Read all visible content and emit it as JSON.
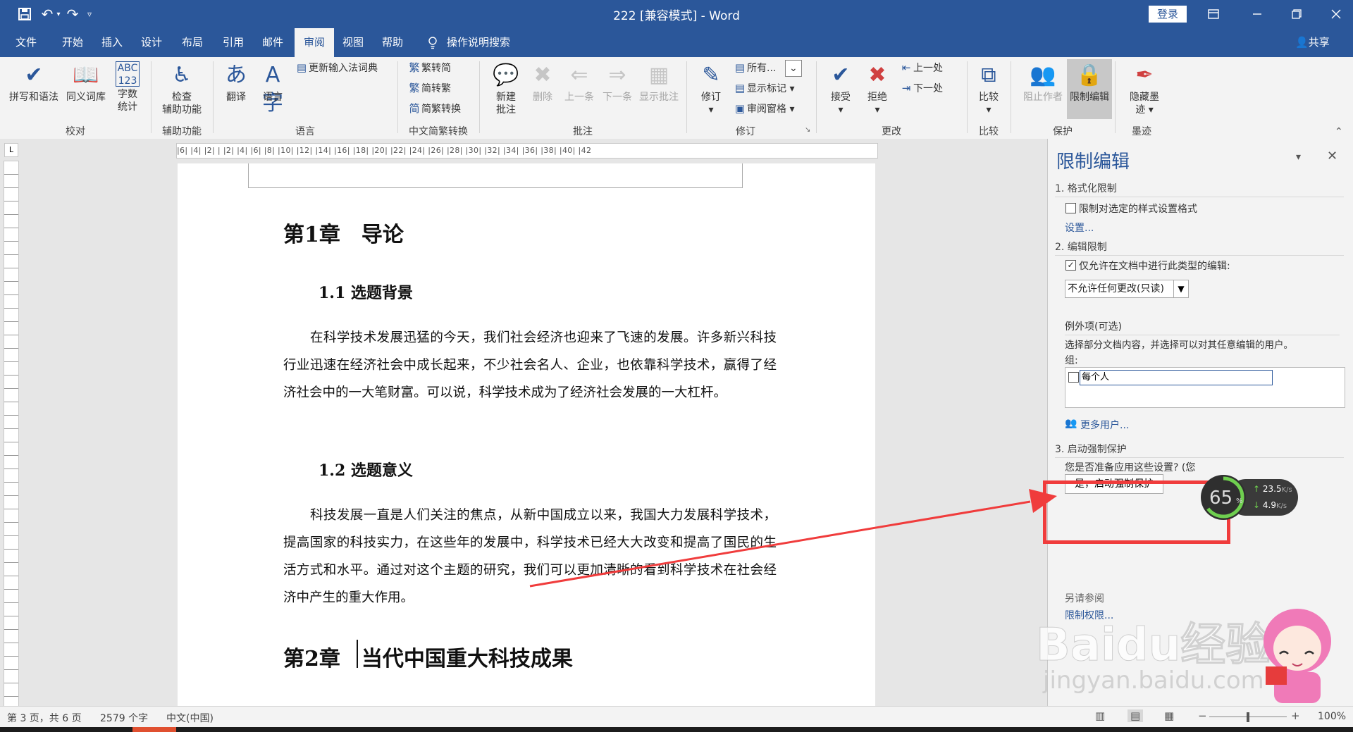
{
  "window": {
    "title": "222 [兼容模式] - Word",
    "login_label": "登录",
    "share_label": "共享",
    "qat_icons": [
      "save-icon",
      "undo-icon",
      "redo-icon",
      "customize-qat-icon"
    ],
    "controls": [
      "ribbon-display-icon",
      "minimize-icon",
      "restore-icon",
      "close-icon"
    ]
  },
  "tabs": [
    {
      "label": "文件"
    },
    {
      "label": "开始"
    },
    {
      "label": "插入"
    },
    {
      "label": "设计"
    },
    {
      "label": "布局"
    },
    {
      "label": "引用"
    },
    {
      "label": "邮件"
    },
    {
      "label": "审阅",
      "active": true
    },
    {
      "label": "视图"
    },
    {
      "label": "帮助"
    }
  ],
  "tell_me": "操作说明搜索",
  "ribbon": {
    "proofing": {
      "group": "校对",
      "spelling": "拼写和语法",
      "thesaurus": "同义词库",
      "wordcount_line1": "字数",
      "wordcount_line2": "统计"
    },
    "accessibility": {
      "group": "辅助功能",
      "check_line1": "检查",
      "check_line2": "辅助功能"
    },
    "language": {
      "group": "语言",
      "translate": "翻译",
      "language": "语言",
      "update_ime": "更新输入法词典"
    },
    "chinese": {
      "group": "中文简繁转换",
      "to_simplified": "繁转简",
      "to_traditional": "简转繁",
      "convert": "简繁转换"
    },
    "comments": {
      "group": "批注",
      "new_line1": "新建",
      "new_line2": "批注",
      "delete": "删除",
      "prev": "上一条",
      "next": "下一条",
      "show": "显示批注"
    },
    "tracking": {
      "group": "修订",
      "track": "修订",
      "all_markup": "所有...",
      "show_markup": "显示标记",
      "review_pane": "审阅窗格"
    },
    "changes": {
      "group": "更改",
      "accept": "接受",
      "reject": "拒绝",
      "previous": "上一处",
      "next": "下一处"
    },
    "compare": {
      "group": "比较",
      "compare": "比较"
    },
    "protect": {
      "group": "保护",
      "block_authors": "阻止作者",
      "restrict_editing": "限制编辑"
    },
    "ink": {
      "group": "墨迹",
      "hide_ink_line1": "隐藏墨",
      "hide_ink_line2": "迹"
    }
  },
  "ruler_marks": "|6| |4| |2| | |2| |4| |6| |8| |10| |12| |14| |16| |18| |20| |22| |24| |26| |28| |30| |32| |34| |36| |38| |40| |42",
  "document": {
    "chapter1": "第1章　导论",
    "sec1": "1.1 选题背景",
    "para1": "在科学技术发展迅猛的今天，我们社会经济也迎来了飞速的发展。许多新兴科技行业迅速在经济社会中成长起来，不少社会名人、企业，也依靠科学技术，赢得了经济社会中的一大笔财富。可以说，科学技术成为了经济社会发展的一大杠杆。",
    "sec2": "1.2 选题意义",
    "para2": "科技发展一直是人们关注的焦点，从新中国成立以来，我国大力发展科学技术，提高国家的科技实力，在这些年的发展中，科学技术已经大大改变和提高了国民的生活方式和水平。通过对这个主题的研究，我们可以更加清晰的看到科学技术在社会经济中产生的重大作用。",
    "chapter2": "第2章　当代中国重大科技成果"
  },
  "pane": {
    "title": "限制编辑",
    "s1": "1. 格式化限制",
    "s1_check": "限制对选定的样式设置格式",
    "s1_link": "设置...",
    "s2": "2. 编辑限制",
    "s2_check": "仅允许在文档中进行此类型的编辑:",
    "s2_select": "不允许任何更改(只读)",
    "exceptions": "例外项(可选)",
    "exceptions_desc": "选择部分文档内容，并选择可以对其任意编辑的用户。",
    "groups": "组:",
    "everyone": "每个人",
    "more_users": "更多用户...",
    "s3": "3. 启动强制保护",
    "s3_q": "您是否准备应用这些设置? (您",
    "s3_btn": "是，启动强制保护",
    "bottom1": "另请参阅",
    "bottom2": "限制权限..."
  },
  "net_widget": {
    "percent": "65",
    "up": "23.5",
    "up_unit": "K/s",
    "down": "4.9",
    "down_unit": "K/s"
  },
  "watermark": {
    "text": "Baidu经验",
    "sub": "jingyan.baidu.com"
  },
  "status": {
    "page": "第 3 页，共 6 页",
    "words": "2579 个字",
    "lang": "中文(中国)",
    "zoom": "100%"
  },
  "colors": {
    "accent": "#2b579a",
    "annotation": "#f03c3c"
  }
}
